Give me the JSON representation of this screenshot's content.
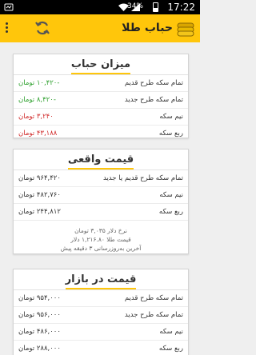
{
  "status_bar": {
    "time": "17:22",
    "battery": "34%"
  },
  "app_bar": {
    "title": "حباب طلا",
    "icons": [
      "menu-icon",
      "refresh-icon",
      "gold-coins-icon"
    ]
  },
  "colors": {
    "accent": "#ffc60b",
    "positive": "#2ea02e",
    "negative": "#d02a2a"
  },
  "bubble_card": {
    "title": "میزان حباب",
    "rows": [
      {
        "label": "تمام سکه طرح قدیم",
        "value": "-۱۰,۴۲۰ تومان"
      },
      {
        "label": "تمام سکه طرح جدید",
        "value": "-۸,۴۲۰ تومان"
      },
      {
        "label": "نیم سکه",
        "value": "۳,۲۴۰ تومان"
      },
      {
        "label": "ربع سکه",
        "value": "۴۳,۱۸۸ تومان"
      }
    ]
  },
  "real_price_card": {
    "title": "قیمت واقعی",
    "rows": [
      {
        "label": "تمام سکه طرح قدیم یا جدید",
        "value": "۹۶۴,۴۲۰ تومان"
      },
      {
        "label": "نیم سکه",
        "value": "۴۸۲,۷۶۰ تومان"
      },
      {
        "label": "ربع سکه",
        "value": "۲۴۴,۸۱۲ تومان"
      }
    ],
    "info": {
      "dollar_rate": "نرخ دلار ۳,۰۳۵ تومان",
      "gold_price": "قیمت طلا ۱,۲۱۶.۸۰ دلار",
      "last_update": "آخرین به‌روزرسانی ۳ دقیقه پیش"
    }
  },
  "market_price_card": {
    "title": "قیمت در بازار",
    "rows": [
      {
        "label": "تمام سکه طرح قدیم",
        "value": "۹۵۴,۰۰۰ تومان"
      },
      {
        "label": "تمام سکه طرح جدید",
        "value": "۹۵۶,۰۰۰ تومان"
      },
      {
        "label": "نیم سکه",
        "value": "۴۸۶,۰۰۰ تومان"
      },
      {
        "label": "ربع سکه",
        "value": "۲۸۸,۰۰۰ تومان"
      }
    ]
  }
}
